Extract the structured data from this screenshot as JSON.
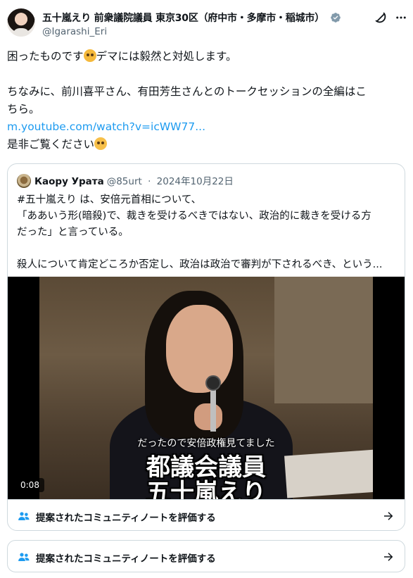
{
  "author": {
    "name": "五十嵐えり 前衆議院議員 東京30区（府中市・多摩市・稲城市）",
    "handle": "@Igarashi_Eri"
  },
  "tweet": {
    "line1": "困ったものです",
    "line1_tail": "デマには毅然と対処します。",
    "line3": "ちなみに、前川喜平さん、有田芳生さんとのトークセッションの全編はこ",
    "line4": "ちら。",
    "link": "m.youtube.com/watch?v=icWW77...",
    "line6": "是非ご覧ください"
  },
  "quote": {
    "name": "Каору Урата",
    "handle": "@85urt",
    "date": "2024年10月22日",
    "lines": [
      "#五十嵐えり は、安倍元首相について、",
      "「ああいう形(暗殺)で、裁きを受けるべきではない、政治的に裁きを受ける方",
      "だった」と言っている。",
      "",
      "殺人について肯定どころか否定し、政治は政治で審判が下されるべき、という..."
    ],
    "video": {
      "subtitle_small": "だったので安倍政権見てました",
      "subtitle_big_1": "都議会議員",
      "subtitle_big_2": "五十嵐えり",
      "timestamp": "0:08"
    },
    "note_label": "提案されたコミュニティノートを評価する"
  },
  "community_note": {
    "label": "提案されたコミュニティノートを評価する"
  },
  "colors": {
    "link": "#1d9bf0",
    "border": "#cfd9de",
    "secondary_text": "#536471",
    "verified_badge": "#829aab"
  },
  "icons": [
    "verified-badge-icon",
    "grok-icon",
    "more-icon",
    "people-icon",
    "arrow-right-icon"
  ]
}
